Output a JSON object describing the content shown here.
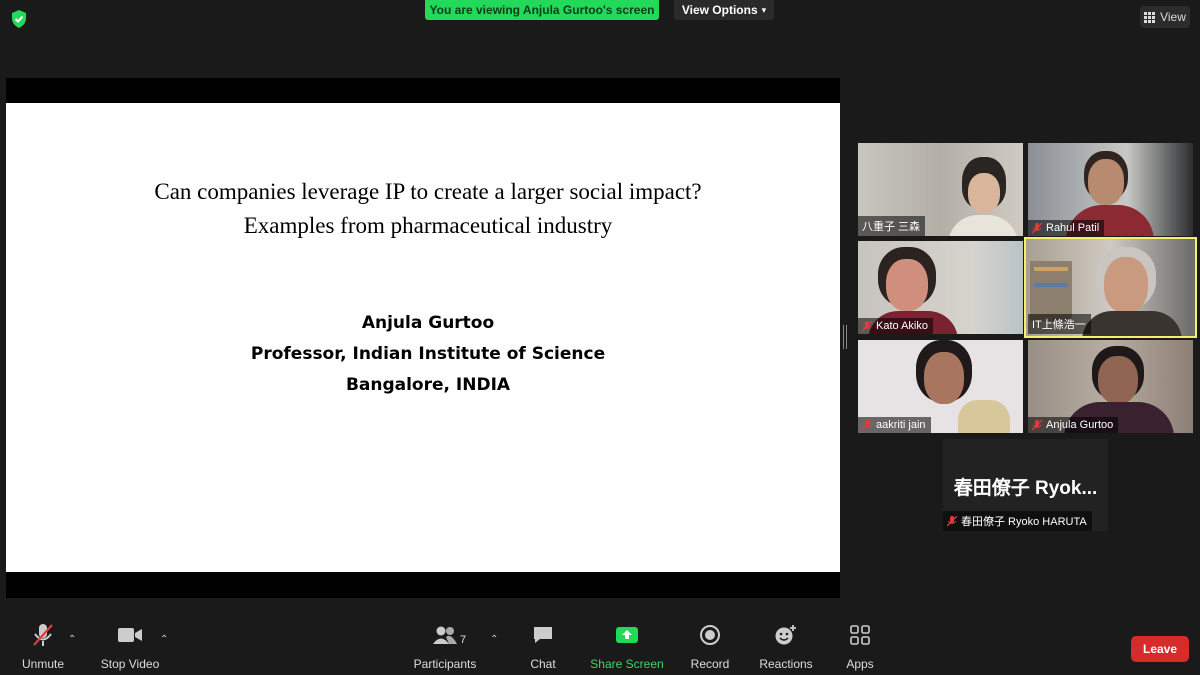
{
  "top": {
    "banner": "You are viewing Anjula Gurtoo's screen",
    "view_options": "View Options",
    "view_button": "View"
  },
  "slide": {
    "title_line1": "Can companies leverage IP to create a larger social impact?",
    "title_line2": "Examples from pharmaceutical industry",
    "author_name": "Anjula Gurtoo",
    "author_title": "Professor,  Indian Institute of Science",
    "author_location": "Bangalore, INDIA"
  },
  "participants": [
    {
      "name": "八重子 三森",
      "muted": false
    },
    {
      "name": "Rahul Patil",
      "muted": true
    },
    {
      "name": "Kato Akiko",
      "muted": true
    },
    {
      "name": "IT上條浩一",
      "muted": false,
      "active_speaker": true
    },
    {
      "name": "aakriti jain",
      "muted": true
    },
    {
      "name": "Anjula Gurtoo",
      "muted": true
    },
    {
      "name": "春田僚子 Ryoko HARUTA",
      "display_big": "春田僚子 Ryok...",
      "muted": true,
      "video_off": true
    }
  ],
  "toolbar": {
    "unmute": "Unmute",
    "stop_video": "Stop Video",
    "participants": "Participants",
    "participant_count": "7",
    "chat": "Chat",
    "share_screen": "Share Screen",
    "record": "Record",
    "reactions": "Reactions",
    "apps": "Apps",
    "leave": "Leave"
  },
  "colors": {
    "background": "#1a1a1a",
    "banner_green": "#23d959",
    "active_speaker": "#f4f06a",
    "leave_red": "#d62b2b",
    "muted_red": "#e03b3b"
  }
}
